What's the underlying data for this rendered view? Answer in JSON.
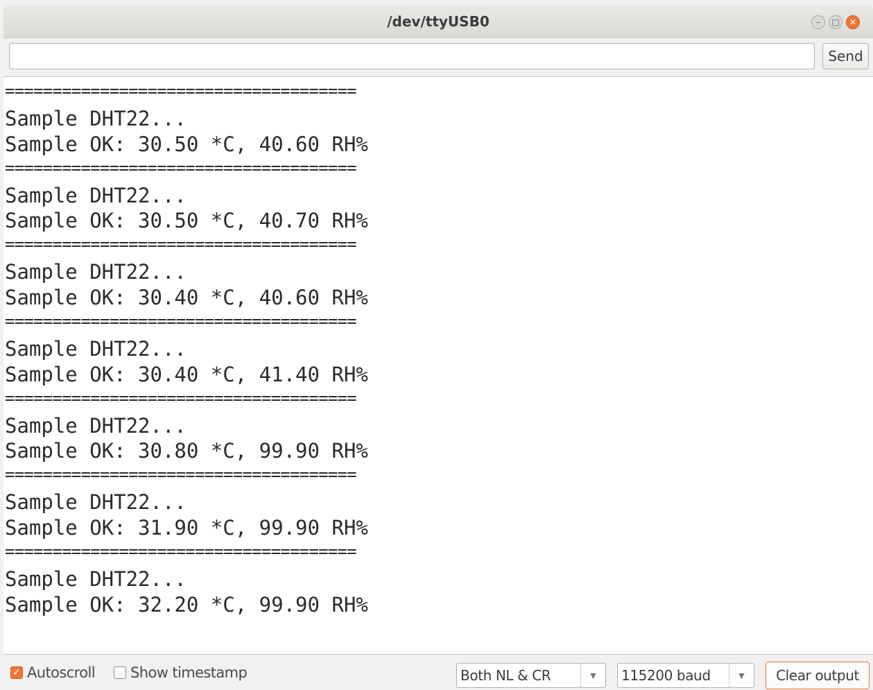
{
  "window": {
    "title": "/dev/ttyUSB0",
    "minimize_glyph": "–",
    "maximize_glyph": "□",
    "close_glyph": "✕"
  },
  "input": {
    "value": "",
    "placeholder": "",
    "send_label": "Send"
  },
  "output": {
    "lines": [
      "=====================================",
      "Sample DHT22...",
      "Sample OK: 30.50 *C, 40.60 RH%",
      "=====================================",
      "Sample DHT22...",
      "Sample OK: 30.50 *C, 40.70 RH%",
      "=====================================",
      "Sample DHT22...",
      "Sample OK: 30.40 *C, 40.60 RH%",
      "=====================================",
      "Sample DHT22...",
      "Sample OK: 30.40 *C, 41.40 RH%",
      "=====================================",
      "Sample DHT22...",
      "Sample OK: 30.80 *C, 99.90 RH%",
      "=====================================",
      "Sample DHT22...",
      "Sample OK: 31.90 *C, 99.90 RH%",
      "=====================================",
      "Sample DHT22...",
      "Sample OK: 32.20 *C, 99.90 RH%"
    ]
  },
  "bottom": {
    "autoscroll_label": "Autoscroll",
    "autoscroll_checked": true,
    "timestamp_label": "Show timestamp",
    "timestamp_checked": false,
    "line_ending_value": "Both NL & CR",
    "baud_value": "115200 baud",
    "clear_label": "Clear output",
    "dropdown_arrow_glyph": "▼",
    "check_glyph": "✓"
  },
  "colors": {
    "accent": "#f0773b",
    "window_bg": "#f2f1f0",
    "output_bg": "#ffffff",
    "text": "#2b2b2b"
  }
}
